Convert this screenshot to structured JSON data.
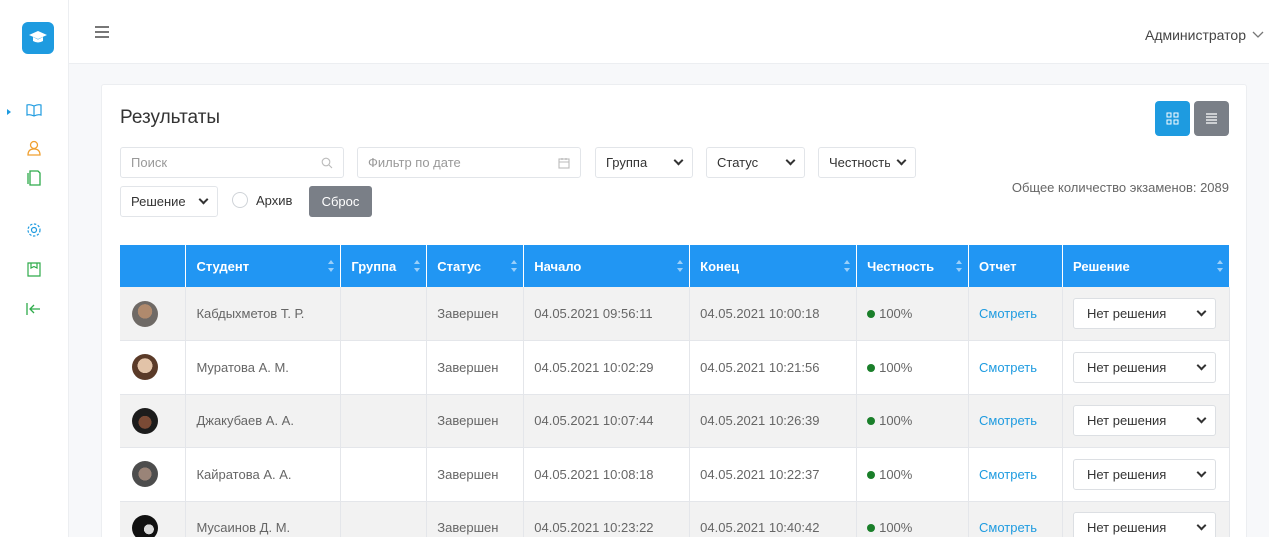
{
  "header": {
    "user_label": "Администратор"
  },
  "page": {
    "title": "Результаты"
  },
  "filters": {
    "search_placeholder": "Поиск",
    "date_placeholder": "Фильтр по дате",
    "group_label": "Группа",
    "status_label": "Статус",
    "honesty_label": "Честность",
    "decision_label": "Решение",
    "archive_label": "Архив",
    "reset_label": "Сброс",
    "total_label": "Общее количество экзаменов: 2089"
  },
  "table": {
    "columns": [
      "Студент",
      "Группа",
      "Статус",
      "Начало",
      "Конец",
      "Честность",
      "Отчет",
      "Решение"
    ],
    "rows": [
      {
        "student": "Кабдыхметов Т. Р.",
        "group": "",
        "status": "Завершен",
        "start": "04.05.2021 09:56:11",
        "end": "04.05.2021 10:00:18",
        "honesty": "100%",
        "report": "Смотреть",
        "decision": "Нет решения"
      },
      {
        "student": "Муратова А. М.",
        "group": "",
        "status": "Завершен",
        "start": "04.05.2021 10:02:29",
        "end": "04.05.2021 10:21:56",
        "honesty": "100%",
        "report": "Смотреть",
        "decision": "Нет решения"
      },
      {
        "student": "Джакубаев А. А.",
        "group": "",
        "status": "Завершен",
        "start": "04.05.2021 10:07:44",
        "end": "04.05.2021 10:26:39",
        "honesty": "100%",
        "report": "Смотреть",
        "decision": "Нет решения"
      },
      {
        "student": "Кайратова А. А.",
        "group": "",
        "status": "Завершен",
        "start": "04.05.2021 10:08:18",
        "end": "04.05.2021 10:22:37",
        "honesty": "100%",
        "report": "Смотреть",
        "decision": "Нет решения"
      },
      {
        "student": "Мусаинов Д. М.",
        "group": "",
        "status": "Завершен",
        "start": "04.05.2021 10:23:22",
        "end": "04.05.2021 10:40:42",
        "honesty": "100%",
        "report": "Смотреть",
        "decision": "Нет решения"
      }
    ]
  },
  "colors": {
    "accent": "#1e9be0",
    "header_bg": "#2196f3",
    "success": "#1a7f2a"
  }
}
